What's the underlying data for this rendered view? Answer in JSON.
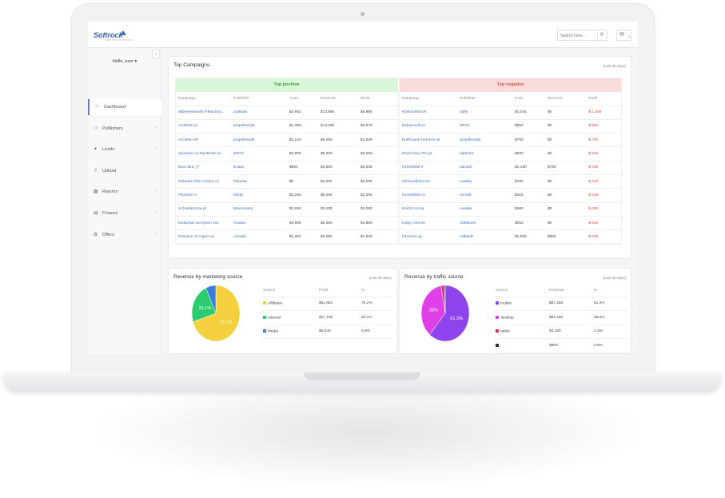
{
  "colors": {
    "accent": "#3a6fc4",
    "positive_bg": "#d9f6d9",
    "negative_bg": "#fbdcdc",
    "loss": "#e0453f"
  },
  "app": {
    "logo": "Softrock",
    "logo_sub": "TECHNOLOGIES"
  },
  "search": {
    "placeholder": "Search here..."
  },
  "mail": {
    "badge": "0"
  },
  "user": {
    "greeting": "Hello, user ▾"
  },
  "sidebar": {
    "items": [
      {
        "label": "Dashboard",
        "icon": "home-icon"
      },
      {
        "label": "Publishers",
        "icon": "users-icon"
      },
      {
        "label": "Leads",
        "icon": "leads-icon"
      },
      {
        "label": "Upload",
        "icon": "upload-icon"
      },
      {
        "label": "Reports",
        "icon": "reports-icon"
      },
      {
        "label": "Finance",
        "icon": "finance-icon"
      },
      {
        "label": "Offers",
        "icon": "offers-icon"
      }
    ]
  },
  "top_campaigns": {
    "title": "Top Campaigns",
    "period": "(Last 30 days)",
    "positive": {
      "heading": "Top positive",
      "columns": [
        "Campaign",
        "Publisher",
        "Cost",
        "Revenue",
        "Profit"
      ],
      "rows": [
        [
          "allbestrewards-it-Macboo...",
          "outbrain",
          "$4,862",
          "$13,850",
          "$8,988"
        ],
        [
          "creditron-pl",
          "propellerads",
          "$7,380",
          "$13,250",
          "$5,870"
        ],
        [
          "mCafee-UK",
          "propellerads",
          "$1,124",
          "$6,050",
          "$4,926"
        ],
        [
          "quiz2win-ca-MacBook Air",
          "DNTX",
          "$4,950",
          "$8,200",
          "$3,250"
        ],
        [
          "ikea card_IT",
          "Evadv",
          "$952",
          "$3,600",
          "$2,648"
        ],
        [
          "Naturals Skin Cream-ca",
          "Taboola",
          "$0",
          "$2,200",
          "$2,200"
        ],
        [
          "Fitonorm-it",
          "MGID",
          "$3,200",
          "$5,400",
          "$2,200"
        ],
        [
          "SchnelleVena-pl",
          "Revcontent",
          "$1,050",
          "$3,100",
          "$2,050"
        ],
        [
          "bookphar-ca-Dyson v11",
          "evadav",
          "$3,500",
          "$5,350",
          "$1,850"
        ],
        [
          "Essence of Argan-ca",
          "Adcash",
          "$1,204",
          "$3,050",
          "$1,846"
        ]
      ]
    },
    "negative": {
      "heading": "Top negative",
      "columns": [
        "Campaign",
        "Publisher",
        "Cost",
        "Revenue",
        "Profit"
      ],
      "rows": [
        [
          "Norton360-UK",
          "adfly",
          "$1,045",
          "$0",
          "$-1,045"
        ],
        [
          "belkacredit-ru",
          "MGID",
          "$952",
          "$0",
          "$-952"
        ],
        [
          "BullGuard Antivirus-uk",
          "propellerads",
          "$760",
          "$0",
          "$-760"
        ],
        [
          "RealAction Pro-pl",
          "adsterra",
          "$600",
          "$0",
          "$-600"
        ],
        [
          "IonicWhite-it",
          "adcash",
          "$1,190",
          "$750",
          "$-440"
        ],
        [
          "minicredits24-es",
          "evadav",
          "$420",
          "$0",
          "$-420"
        ],
        [
          "IonicWhite-cz",
          "ezmob",
          "$315",
          "$0",
          "$-315"
        ],
        [
          "lime24-co-za",
          "evadav",
          "$260",
          "$0",
          "$-260"
        ],
        [
          "mspy-com-es",
          "AdMaven",
          "$252",
          "$0",
          "$-252"
        ],
        [
          "Fitonorm-gr",
          "Adblade",
          "$1,008",
          "$800",
          "$-208"
        ]
      ]
    }
  },
  "revenue_marketing": {
    "title": "Revenue by marketing source",
    "period": "(Last 30 days)",
    "columns": [
      "Source",
      "Profit",
      "%"
    ],
    "rows": [
      {
        "source": "Affiliates",
        "value": "$51,861",
        "pct": "70.1%",
        "share": 70.1,
        "color": "#f4d03f"
      },
      {
        "source": "Internal",
        "value": "$17,100",
        "pct": "23.1%",
        "share": 23.1,
        "color": "#2ecc71"
      },
      {
        "source": "Media",
        "value": "$5,040",
        "pct": "6.8%",
        "share": 6.8,
        "color": "#3b7ddd"
      }
    ],
    "slice_labels": [
      "70.1%",
      "23.1%"
    ]
  },
  "revenue_traffic": {
    "title": "Revenue by traffic source",
    "period": "(Last 30 days)",
    "columns": [
      "Source",
      "Revenue",
      "%"
    ],
    "rows": [
      {
        "source": "mobile",
        "value": "$87,250",
        "pct": "61.3%",
        "share": 61.3,
        "color": "#8e44ec"
      },
      {
        "source": "desktop",
        "value": "$51,200",
        "pct": "36.0%",
        "share": 36.0,
        "color": "#e040e8"
      },
      {
        "source": "tablet",
        "value": "$3,150",
        "pct": "2.2%",
        "share": 2.2,
        "color": "#e0287a"
      },
      {
        "source": "-",
        "value": "$800",
        "pct": "0.6%",
        "share": 0.6,
        "color": "#333333"
      }
    ],
    "slice_labels": [
      "61.3%",
      "36%"
    ]
  }
}
